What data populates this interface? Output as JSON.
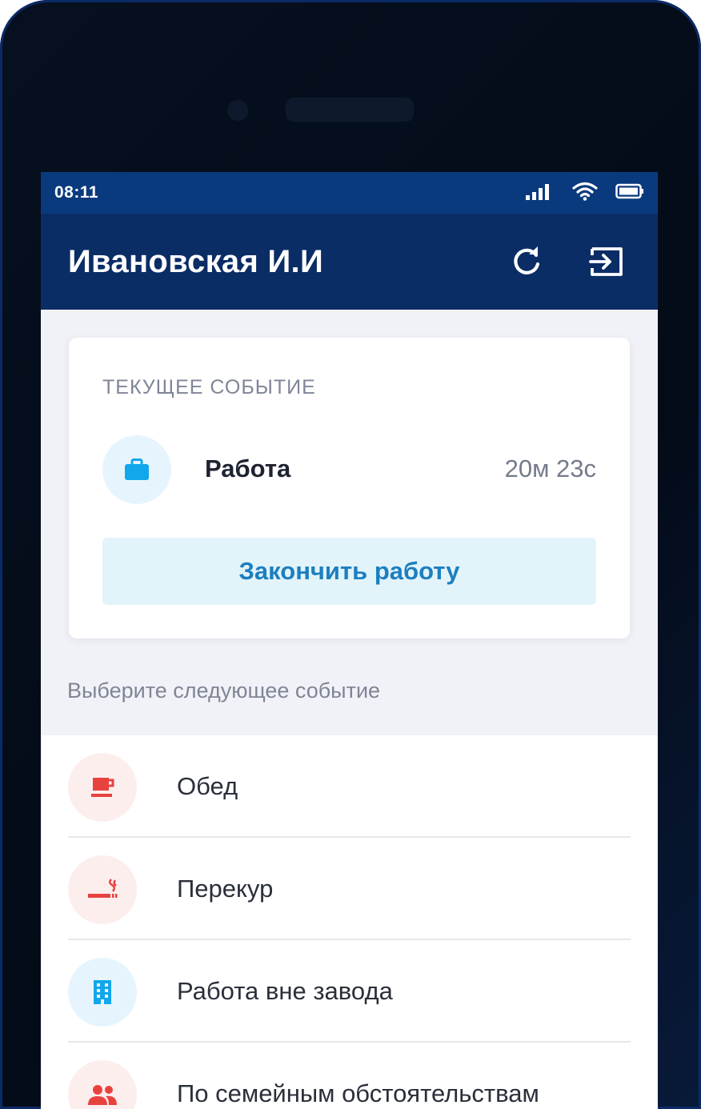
{
  "status_bar": {
    "time": "08:11"
  },
  "app_bar": {
    "title": "Ивановская И.И"
  },
  "current_event": {
    "label": "ТЕКУЩЕЕ СОБЫТИЕ",
    "name": "Работа",
    "duration": "20м 23с",
    "finish_button": "Закончить работу"
  },
  "next_events": {
    "title": "Выберите следующее событие",
    "items": [
      {
        "label": "Обед",
        "icon": "coffee-cup-icon"
      },
      {
        "label": "Перекур",
        "icon": "smoking-icon"
      },
      {
        "label": "Работа вне завода",
        "icon": "building-icon"
      },
      {
        "label": "По семейным обстоятельствам",
        "icon": "family-icon"
      }
    ]
  },
  "colors": {
    "app_bar": "#0b2d66",
    "status_bar": "#0a3a7e",
    "accent_blue": "#1b7fc0",
    "accent_red": "#e8423f",
    "icon_blue": "#12a7ea"
  }
}
